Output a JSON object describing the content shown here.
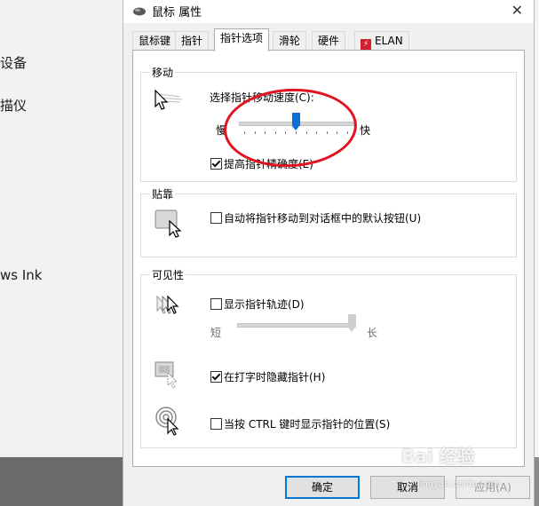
{
  "background_window": {
    "lines": [
      "设备",
      "描仪",
      "ws Ink"
    ]
  },
  "dialog": {
    "title": "鼠标 属性",
    "close_symbol": "✕",
    "tabs": [
      {
        "label": "鼠标键",
        "active": false
      },
      {
        "label": "指针",
        "active": false
      },
      {
        "label": "指针选项",
        "active": true
      },
      {
        "label": "滑轮",
        "active": false
      },
      {
        "label": "硬件",
        "active": false
      },
      {
        "label": "ELAN",
        "active": false,
        "icon": "elan-logo-icon"
      }
    ],
    "motion": {
      "group_label": "移动",
      "speed_label": "选择指针移动速度(C):",
      "slow_label": "慢",
      "fast_label": "快",
      "speed_value": 0.5,
      "precision_label": "提高指针精确度(E)",
      "precision_checked": true
    },
    "snap": {
      "group_label": "贴靠",
      "snap_label": "自动将指针移动到对话框中的默认按钮(U)",
      "snap_checked": false
    },
    "visibility": {
      "group_label": "可见性",
      "trails_label": "显示指针轨迹(D)",
      "trails_checked": false,
      "short_label": "短",
      "long_label": "长",
      "trails_value": 1.0,
      "hide_label": "在打字时隐藏指针(H)",
      "hide_checked": true,
      "ctrl_label": "当按 CTRL 键时显示指针的位置(S)",
      "ctrl_checked": false
    },
    "buttons": {
      "ok": "确定",
      "cancel": "取消",
      "apply": "应用(A)"
    }
  },
  "watermark": {
    "text": "Bai 经验",
    "sub": "jingyan.baidu.com"
  },
  "colors": {
    "annotation": "#e1141f",
    "slider_thumb": "#0a6fd6",
    "default_button_border": "#0078d7"
  }
}
